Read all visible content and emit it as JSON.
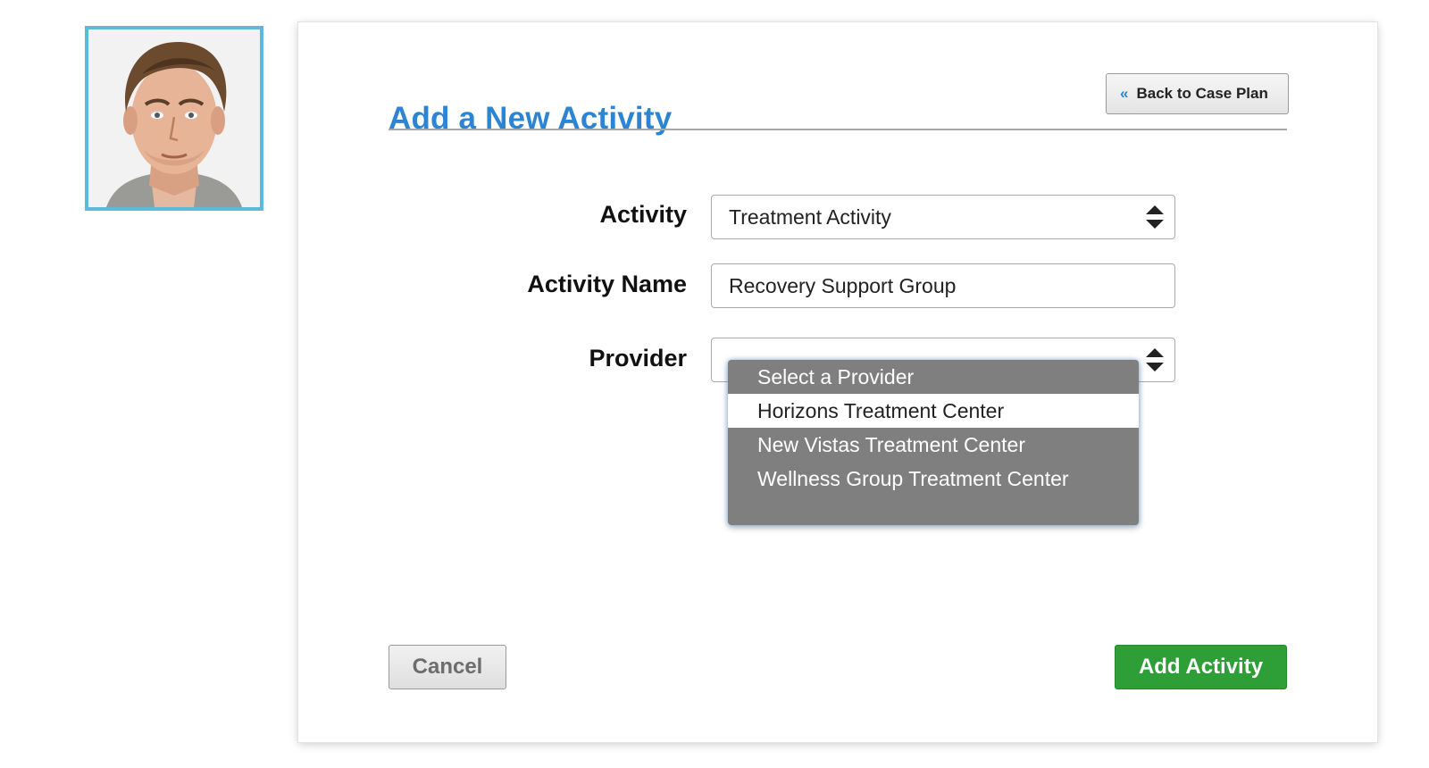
{
  "page": {
    "title": "Add a New Activity",
    "back_button_label": "Back to Case Plan",
    "back_icon": "double-chevron-left-icon"
  },
  "avatar": {
    "description_icon": "user-photo"
  },
  "form": {
    "activity": {
      "label": "Activity",
      "value": "Treatment Activity"
    },
    "activity_name": {
      "label": "Activity Name",
      "value": "Recovery Support Group"
    },
    "provider": {
      "label": "Provider",
      "options": [
        "Select a Provider",
        "Horizons Treatment Center",
        "New Vistas Treatment Center",
        "Wellness Group Treatment Center"
      ],
      "highlighted_option": "Horizons Treatment Center"
    }
  },
  "actions": {
    "cancel_label": "Cancel",
    "submit_label": "Add Activity"
  },
  "colors": {
    "title": "#2d84d3",
    "avatar_border": "#5bb9d9",
    "submit": "#2e9e36",
    "dropdown_bg": "#7f7f7f"
  }
}
